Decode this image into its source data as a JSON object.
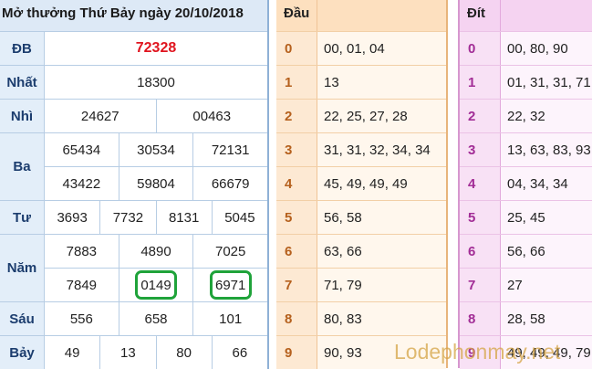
{
  "results": {
    "header": "Mở thưởng Thứ Bảy ngày 20/10/2018",
    "rows": [
      {
        "label": "ĐB",
        "lines": [
          [
            "72328"
          ]
        ],
        "special": true
      },
      {
        "label": "Nhất",
        "lines": [
          [
            "18300"
          ]
        ]
      },
      {
        "label": "Nhì",
        "lines": [
          [
            "24627",
            "00463"
          ]
        ]
      },
      {
        "label": "Ba",
        "lines": [
          [
            "65434",
            "30534",
            "72131"
          ],
          [
            "43422",
            "59804",
            "66679"
          ]
        ]
      },
      {
        "label": "Tư",
        "lines": [
          [
            "3693",
            "7732",
            "8131",
            "5045"
          ]
        ]
      },
      {
        "label": "Năm",
        "lines": [
          [
            "7883",
            "4890",
            "7025"
          ],
          [
            "7849",
            "0149",
            "6971"
          ]
        ]
      },
      {
        "label": "Sáu",
        "lines": [
          [
            "556",
            "658",
            "101"
          ]
        ]
      },
      {
        "label": "Bảy",
        "lines": [
          [
            "49",
            "13",
            "80",
            "66"
          ]
        ]
      }
    ],
    "circled": [
      "0149",
      "6971"
    ],
    "colors": {
      "special": "#e0141e",
      "circle": "#1fa33a",
      "header_bg": "#dde9f6"
    }
  },
  "head_table": {
    "header": "Đầu",
    "rows": [
      {
        "key": "0",
        "values": "00, 01, 04"
      },
      {
        "key": "1",
        "values": "13"
      },
      {
        "key": "2",
        "values": "22, 25, 27, 28"
      },
      {
        "key": "3",
        "values": "31, 31, 32, 34, 34"
      },
      {
        "key": "4",
        "values": "45, 49, 49, 49"
      },
      {
        "key": "5",
        "values": "56, 58"
      },
      {
        "key": "6",
        "values": "63, 66"
      },
      {
        "key": "7",
        "values": "71, 79"
      },
      {
        "key": "8",
        "values": "80, 83"
      },
      {
        "key": "9",
        "values": "90, 93"
      }
    ]
  },
  "tail_table": {
    "header": "Đít",
    "rows": [
      {
        "key": "0",
        "values": "00, 80, 90"
      },
      {
        "key": "1",
        "values": "01, 31, 31, 71"
      },
      {
        "key": "2",
        "values": "22, 32"
      },
      {
        "key": "3",
        "values": "13, 63, 83, 93"
      },
      {
        "key": "4",
        "values": "04, 34, 34"
      },
      {
        "key": "5",
        "values": "25, 45"
      },
      {
        "key": "6",
        "values": "56, 66"
      },
      {
        "key": "7",
        "values": "27"
      },
      {
        "key": "8",
        "values": "28, 58"
      },
      {
        "key": "9",
        "values": "49, 49, 49, 79"
      }
    ]
  },
  "watermark": "Lodephonmay.net"
}
